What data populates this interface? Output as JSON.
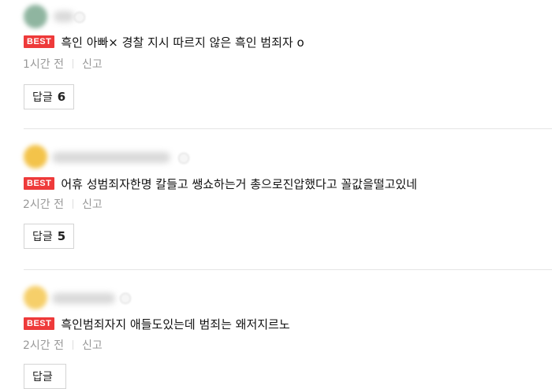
{
  "comments": [
    {
      "badge": "BEST",
      "text": "흑인 아빠× 경찰 지시 따르지 않은 흑인 범죄자 o",
      "time": "1시간 전",
      "report": "신고",
      "reply_label": "답글",
      "reply_count": "6",
      "avatar_color": "#8fb5a0"
    },
    {
      "badge": "BEST",
      "text": "어휴 성범죄자한명 칼들고 쌩쇼하는거 총으로진압했다고 꼴값을떨고있네",
      "time": "2시간 전",
      "report": "신고",
      "reply_label": "답글",
      "reply_count": "5",
      "avatar_color": "#f3c34a"
    },
    {
      "badge": "BEST",
      "text": "흑인범죄자지 애들도있는데 범죄는 왜저지르노",
      "time": "2시간 전",
      "report": "신고",
      "reply_label": "답글",
      "reply_count": "",
      "avatar_color": "#f6cf6a"
    }
  ]
}
